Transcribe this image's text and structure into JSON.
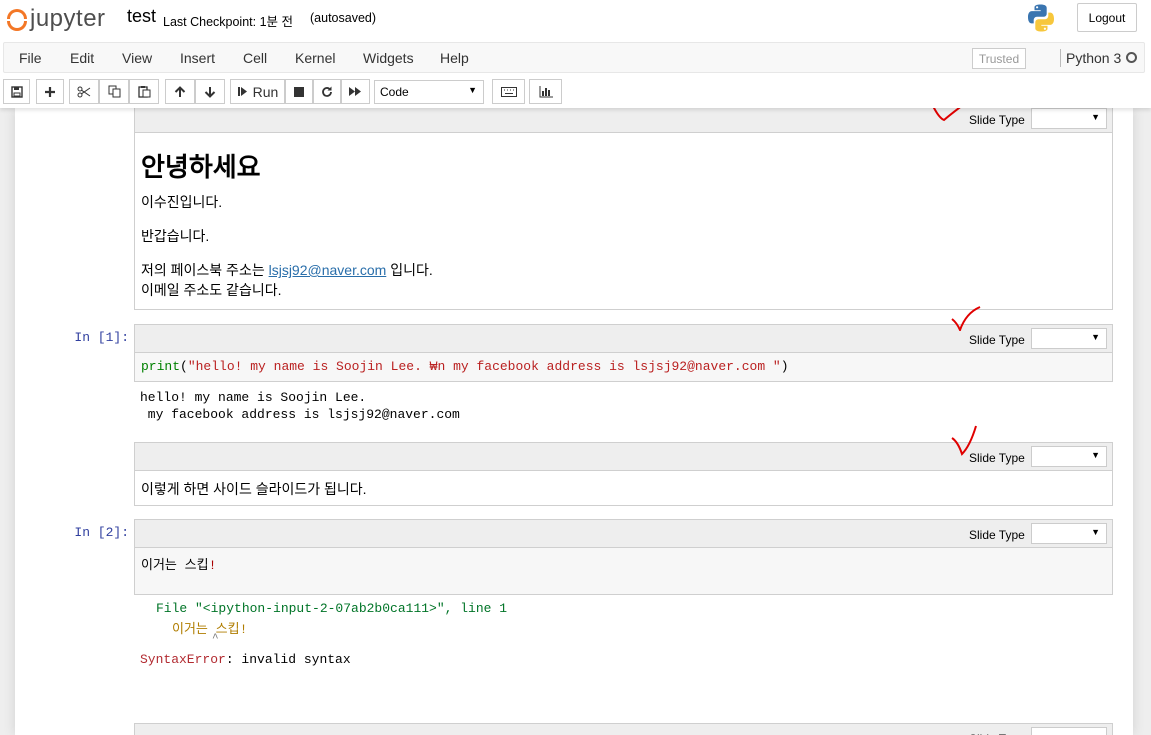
{
  "header": {
    "logo_text": "jupyter",
    "notebook_name": "test",
    "checkpoint": "Last Checkpoint: 1분 전",
    "autosaved": "(autosaved)",
    "logout": "Logout"
  },
  "menu": {
    "items": [
      "File",
      "Edit",
      "View",
      "Insert",
      "Cell",
      "Kernel",
      "Widgets",
      "Help"
    ],
    "trusted": "Trusted",
    "kernel": "Python 3"
  },
  "toolbar": {
    "run_label": "Run",
    "cell_type": "Code"
  },
  "cells": {
    "slide_type_label": "Slide Type",
    "md1": {
      "heading": "안녕하세요",
      "p1": "이수진입니다.",
      "p2": "반갑습니다.",
      "p3_before": "저의 페이스북 주소는",
      "p3_link": "lsjsj92@naver.com",
      "p3_after": "입니다.",
      "p4": "이메일 주소도 같습니다."
    },
    "code1": {
      "prompt": "In [1]:",
      "code_fn": "print",
      "code_str": "\"hello! my name is Soojin Lee. ₩n my facebook address is lsjsj92@naver.com \"",
      "output_line1": "hello! my name is Soojin Lee.",
      "output_line2": " my facebook address is lsjsj92@naver.com"
    },
    "md2": {
      "text": "이렇게 하면 사이드 슬라이드가 됩니다."
    },
    "code2": {
      "prompt": "In [2]:",
      "code_text": "이거는 스킵",
      "code_punct": "!",
      "err_file": "File \"<ipython-input-2-07ab2b0ca111>\", line 1",
      "err_code": "이거는 스킵!",
      "err_caret": "^",
      "err_name": "SyntaxError",
      "err_msg": ": invalid syntax"
    }
  },
  "colors": {
    "accent": "#f37726",
    "check_mark": "#e00000",
    "prompt_in": "#303f9f",
    "link": "#296eaa"
  },
  "icons": [
    "save-icon",
    "plus-icon",
    "scissors-icon",
    "copy-icon",
    "paste-icon",
    "arrow-up-icon",
    "arrow-down-icon",
    "step-forward-icon",
    "stop-icon",
    "restart-icon",
    "fast-forward-icon",
    "keyboard-icon",
    "bar-chart-icon",
    "python-logo-icon"
  ]
}
